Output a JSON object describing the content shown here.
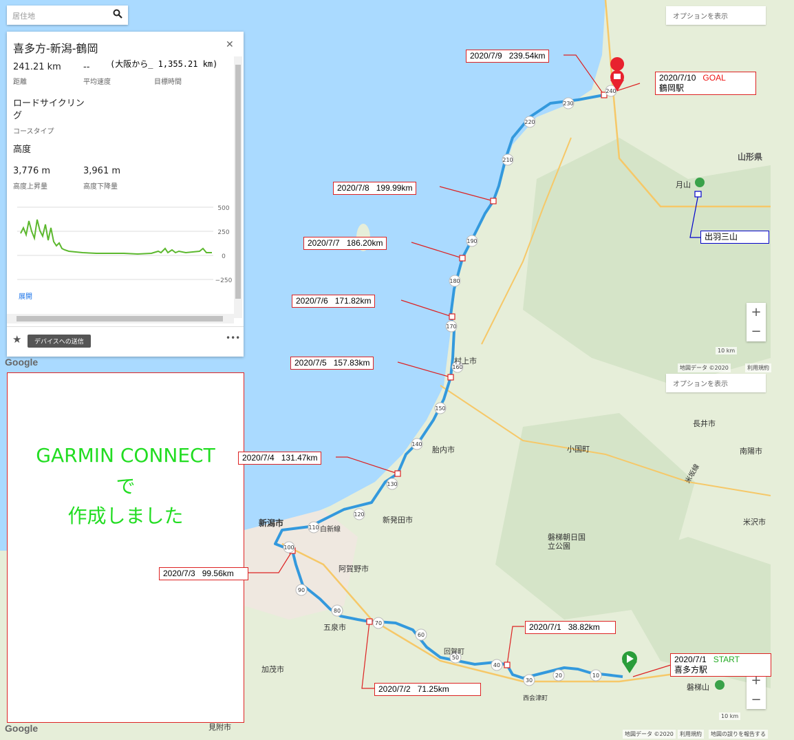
{
  "search": {
    "placeholder": "居住地"
  },
  "panel": {
    "title": "喜多方-新潟-鶴岡",
    "distance": "241.21 km",
    "distance_label": "距離",
    "avg_speed": "--",
    "avg_speed_label": "平均速度",
    "note": "(大阪から_ 1,355.21 km)",
    "target_time_label": "目標時間",
    "course_type": "ロードサイクリング",
    "course_type_label": "コースタイプ",
    "elevation_heading": "高度",
    "ascent": "3,776 m",
    "ascent_label": "高度上昇量",
    "descent": "3,961 m",
    "descent_label": "高度下降量",
    "yticks": [
      "500",
      "250",
      "0",
      "−250"
    ],
    "expand": "展開",
    "send_button": "デバイスへの送信"
  },
  "options_label": "オプションを表示",
  "google": "Google",
  "map_copyright": "地図データ ©2020",
  "terms": "利用規約",
  "report": "地図の誤りを報告する",
  "scale": "10 km",
  "garmin": [
    "GARMIN CONNECT",
    "で",
    "作成しました"
  ],
  "labels": [
    {
      "date": "2020/7/9",
      "dist": "239.54km"
    },
    {
      "date": "2020/7/10",
      "tag": "GOAL",
      "station": "鶴岡駅"
    },
    {
      "date": "2020/7/8",
      "dist": "199.99km"
    },
    {
      "date": "2020/7/7",
      "dist": "186.20km"
    },
    {
      "date": "2020/7/6",
      "dist": "171.82km"
    },
    {
      "date": "2020/7/5",
      "dist": "157.83km"
    },
    {
      "date": "2020/7/4",
      "dist": "131.47km"
    },
    {
      "date": "2020/7/3",
      "dist": "99.56km"
    },
    {
      "date": "2020/7/2",
      "dist": "71.25km"
    },
    {
      "date": "2020/7/1",
      "dist": "38.82km"
    },
    {
      "date": "2020/7/1",
      "tag": "START",
      "station": "喜多方駅"
    }
  ],
  "dewa": "出羽三山",
  "places": [
    "山形県",
    "月山",
    "新潟市",
    "新発田市",
    "胎内市",
    "村上市",
    "阿賀野市",
    "五泉市",
    "加茂市",
    "小国町",
    "長井市",
    "南陽市",
    "米沢市",
    "磐梯朝日国立公園",
    "西会津町",
    "磐梯山",
    "見附市",
    "白新線",
    "米坂線",
    "回賀町"
  ],
  "km_markers": [
    "230",
    "220",
    "210",
    "190",
    "180",
    "170",
    "160",
    "150",
    "140",
    "130",
    "120",
    "110",
    "100",
    "90",
    "80",
    "70",
    "60",
    "50",
    "40",
    "30",
    "20",
    "10",
    "240"
  ],
  "colors": {
    "route": "#3399dd",
    "sea": "#aadaff",
    "land": "#e8efdc",
    "label_border": "#dd2222",
    "start": "#2a9d3a",
    "goal": "#e8222e"
  }
}
